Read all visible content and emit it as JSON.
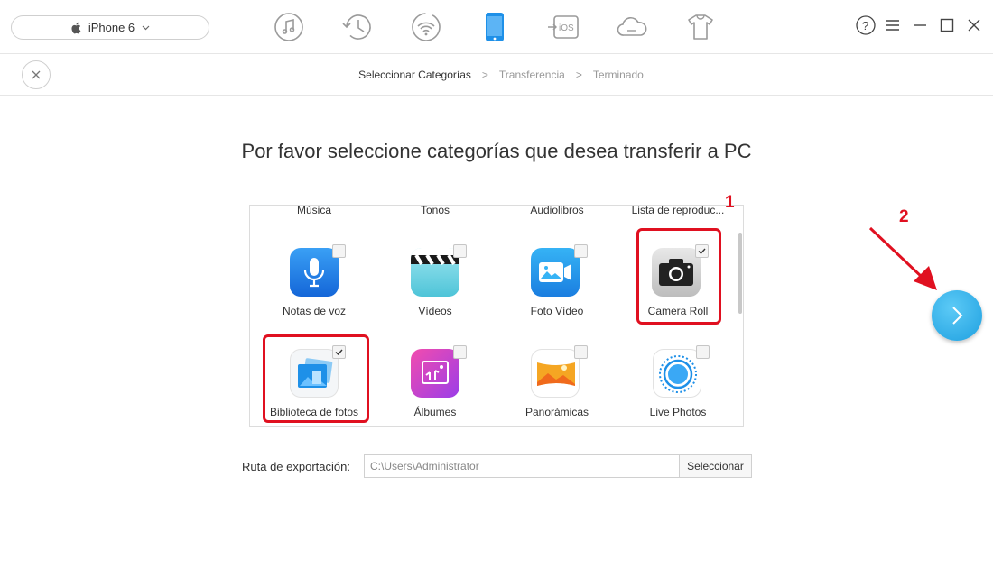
{
  "device": {
    "name": "iPhone 6"
  },
  "nav_icons": [
    "music-icon",
    "history-icon",
    "wifi-icon",
    "iphone-icon",
    "ios-transfer-icon",
    "cloud-icon",
    "tshirt-icon"
  ],
  "window_controls": [
    "help-icon",
    "menu-icon",
    "minimize-icon",
    "maximize-icon",
    "close-icon"
  ],
  "steps": [
    "Seleccionar Categorías",
    "Transferencia",
    "Terminado"
  ],
  "steps_sep": ">",
  "heading": "Por favor seleccione categorías que desea transferir a PC",
  "categories_top": [
    "Música",
    "Tonos",
    "Audiolibros",
    "Lista de reproduc..."
  ],
  "categories": [
    {
      "label": "Notas de voz",
      "checked": false
    },
    {
      "label": "Vídeos",
      "checked": false
    },
    {
      "label": "Foto Vídeo",
      "checked": false
    },
    {
      "label": "Camera Roll",
      "checked": true
    },
    {
      "label": "Biblioteca de fotos",
      "checked": true
    },
    {
      "label": "Álbumes",
      "checked": false
    },
    {
      "label": "Panorámicas",
      "checked": false
    },
    {
      "label": "Live Photos",
      "checked": false
    }
  ],
  "annotations": {
    "badge1": "1",
    "badge2": "2",
    "highlight_color": "#e01020"
  },
  "export": {
    "label": "Ruta de exportación:",
    "path": "C:\\Users\\Administrator",
    "button": "Seleccionar"
  },
  "colors": {
    "accent": "#1fa0e0",
    "active_nav": "#1e90e8"
  }
}
